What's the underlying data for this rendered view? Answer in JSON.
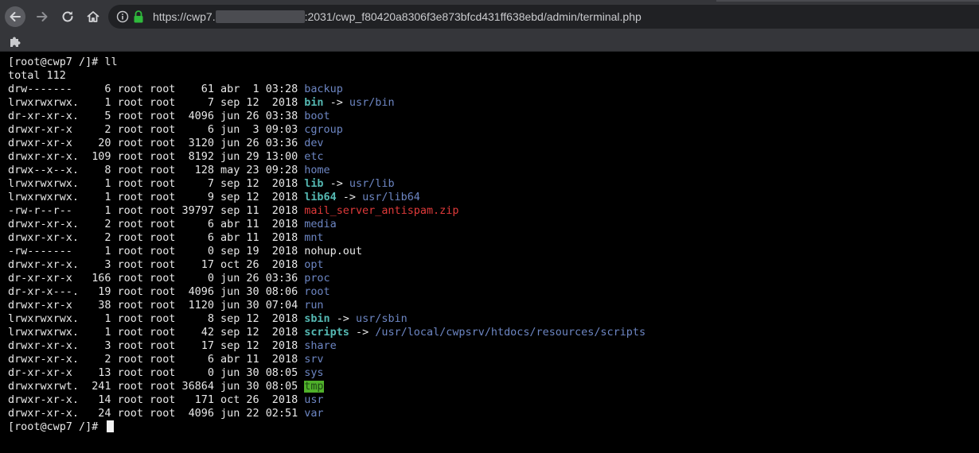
{
  "browser": {
    "url_prefix": "https://cwp7.",
    "url_suffix": ":2031/cwp_f80420a8306f3e873bfcd431ff638ebd/admin/terminal.php"
  },
  "terminal": {
    "prompt": "[root@cwp7 /]# ",
    "command": "ll",
    "total": "total 112",
    "entries": [
      {
        "perm": "drw-------  ",
        "links": "  6",
        "owner": "root",
        "group": "root",
        "size": "   61",
        "month": "abr",
        "day": " 1",
        "time": "03:28",
        "name": "backup",
        "type": "dir",
        "target": ""
      },
      {
        "perm": "lrwxrwxrwx. ",
        "links": "  1",
        "owner": "root",
        "group": "root",
        "size": "    7",
        "month": "sep",
        "day": "12",
        "time": " 2018",
        "name": "bin",
        "type": "link",
        "target": "usr/bin"
      },
      {
        "perm": "dr-xr-xr-x. ",
        "links": "  5",
        "owner": "root",
        "group": "root",
        "size": " 4096",
        "month": "jun",
        "day": "26",
        "time": "03:38",
        "name": "boot",
        "type": "dir",
        "target": ""
      },
      {
        "perm": "drwxr-xr-x  ",
        "links": "  2",
        "owner": "root",
        "group": "root",
        "size": "    6",
        "month": "jun",
        "day": " 3",
        "time": "09:03",
        "name": "cgroup",
        "type": "dir",
        "target": ""
      },
      {
        "perm": "drwxr-xr-x  ",
        "links": " 20",
        "owner": "root",
        "group": "root",
        "size": " 3120",
        "month": "jun",
        "day": "26",
        "time": "03:36",
        "name": "dev",
        "type": "dir",
        "target": ""
      },
      {
        "perm": "drwxr-xr-x. ",
        "links": "109",
        "owner": "root",
        "group": "root",
        "size": " 8192",
        "month": "jun",
        "day": "29",
        "time": "13:00",
        "name": "etc",
        "type": "dir",
        "target": ""
      },
      {
        "perm": "drwx--x--x. ",
        "links": "  8",
        "owner": "root",
        "group": "root",
        "size": "  128",
        "month": "may",
        "day": "23",
        "time": "09:28",
        "name": "home",
        "type": "dir",
        "target": ""
      },
      {
        "perm": "lrwxrwxrwx. ",
        "links": "  1",
        "owner": "root",
        "group": "root",
        "size": "    7",
        "month": "sep",
        "day": "12",
        "time": " 2018",
        "name": "lib",
        "type": "link",
        "target": "usr/lib"
      },
      {
        "perm": "lrwxrwxrwx. ",
        "links": "  1",
        "owner": "root",
        "group": "root",
        "size": "    9",
        "month": "sep",
        "day": "12",
        "time": " 2018",
        "name": "lib64",
        "type": "link",
        "target": "usr/lib64"
      },
      {
        "perm": "-rw-r--r--  ",
        "links": "  1",
        "owner": "root",
        "group": "root",
        "size": "39797",
        "month": "sep",
        "day": "11",
        "time": " 2018",
        "name": "mail_server_antispam.zip",
        "type": "zip",
        "target": ""
      },
      {
        "perm": "drwxr-xr-x. ",
        "links": "  2",
        "owner": "root",
        "group": "root",
        "size": "    6",
        "month": "abr",
        "day": "11",
        "time": " 2018",
        "name": "media",
        "type": "dir",
        "target": ""
      },
      {
        "perm": "drwxr-xr-x. ",
        "links": "  2",
        "owner": "root",
        "group": "root",
        "size": "    6",
        "month": "abr",
        "day": "11",
        "time": " 2018",
        "name": "mnt",
        "type": "dir",
        "target": ""
      },
      {
        "perm": "-rw-------  ",
        "links": "  1",
        "owner": "root",
        "group": "root",
        "size": "    0",
        "month": "sep",
        "day": "19",
        "time": " 2018",
        "name": "nohup.out",
        "type": "plain",
        "target": ""
      },
      {
        "perm": "drwxr-xr-x. ",
        "links": "  3",
        "owner": "root",
        "group": "root",
        "size": "   17",
        "month": "oct",
        "day": "26",
        "time": " 2018",
        "name": "opt",
        "type": "dir",
        "target": ""
      },
      {
        "perm": "dr-xr-xr-x  ",
        "links": "166",
        "owner": "root",
        "group": "root",
        "size": "    0",
        "month": "jun",
        "day": "26",
        "time": "03:36",
        "name": "proc",
        "type": "dir",
        "target": ""
      },
      {
        "perm": "dr-xr-x---. ",
        "links": " 19",
        "owner": "root",
        "group": "root",
        "size": " 4096",
        "month": "jun",
        "day": "30",
        "time": "08:06",
        "name": "root",
        "type": "dir",
        "target": ""
      },
      {
        "perm": "drwxr-xr-x  ",
        "links": " 38",
        "owner": "root",
        "group": "root",
        "size": " 1120",
        "month": "jun",
        "day": "30",
        "time": "07:04",
        "name": "run",
        "type": "dir",
        "target": ""
      },
      {
        "perm": "lrwxrwxrwx. ",
        "links": "  1",
        "owner": "root",
        "group": "root",
        "size": "    8",
        "month": "sep",
        "day": "12",
        "time": " 2018",
        "name": "sbin",
        "type": "link",
        "target": "usr/sbin"
      },
      {
        "perm": "lrwxrwxrwx. ",
        "links": "  1",
        "owner": "root",
        "group": "root",
        "size": "   42",
        "month": "sep",
        "day": "12",
        "time": " 2018",
        "name": "scripts",
        "type": "link",
        "target": "/usr/local/cwpsrv/htdocs/resources/scripts"
      },
      {
        "perm": "drwxr-xr-x. ",
        "links": "  3",
        "owner": "root",
        "group": "root",
        "size": "   17",
        "month": "sep",
        "day": "12",
        "time": " 2018",
        "name": "share",
        "type": "dir",
        "target": ""
      },
      {
        "perm": "drwxr-xr-x. ",
        "links": "  2",
        "owner": "root",
        "group": "root",
        "size": "    6",
        "month": "abr",
        "day": "11",
        "time": " 2018",
        "name": "srv",
        "type": "dir",
        "target": ""
      },
      {
        "perm": "dr-xr-xr-x  ",
        "links": " 13",
        "owner": "root",
        "group": "root",
        "size": "    0",
        "month": "jun",
        "day": "30",
        "time": "08:05",
        "name": "sys",
        "type": "dir",
        "target": ""
      },
      {
        "perm": "drwxrwxrwt. ",
        "links": "241",
        "owner": "root",
        "group": "root",
        "size": "36864",
        "month": "jun",
        "day": "30",
        "time": "08:05",
        "name": "tmp",
        "type": "sticky",
        "target": ""
      },
      {
        "perm": "drwxr-xr-x. ",
        "links": " 14",
        "owner": "root",
        "group": "root",
        "size": "  171",
        "month": "oct",
        "day": "26",
        "time": " 2018",
        "name": "usr",
        "type": "dir",
        "target": ""
      },
      {
        "perm": "drwxr-xr-x. ",
        "links": " 24",
        "owner": "root",
        "group": "root",
        "size": " 4096",
        "month": "jun",
        "day": "22",
        "time": "02:51",
        "name": "var",
        "type": "dir",
        "target": ""
      }
    ],
    "arrow": " -> "
  }
}
